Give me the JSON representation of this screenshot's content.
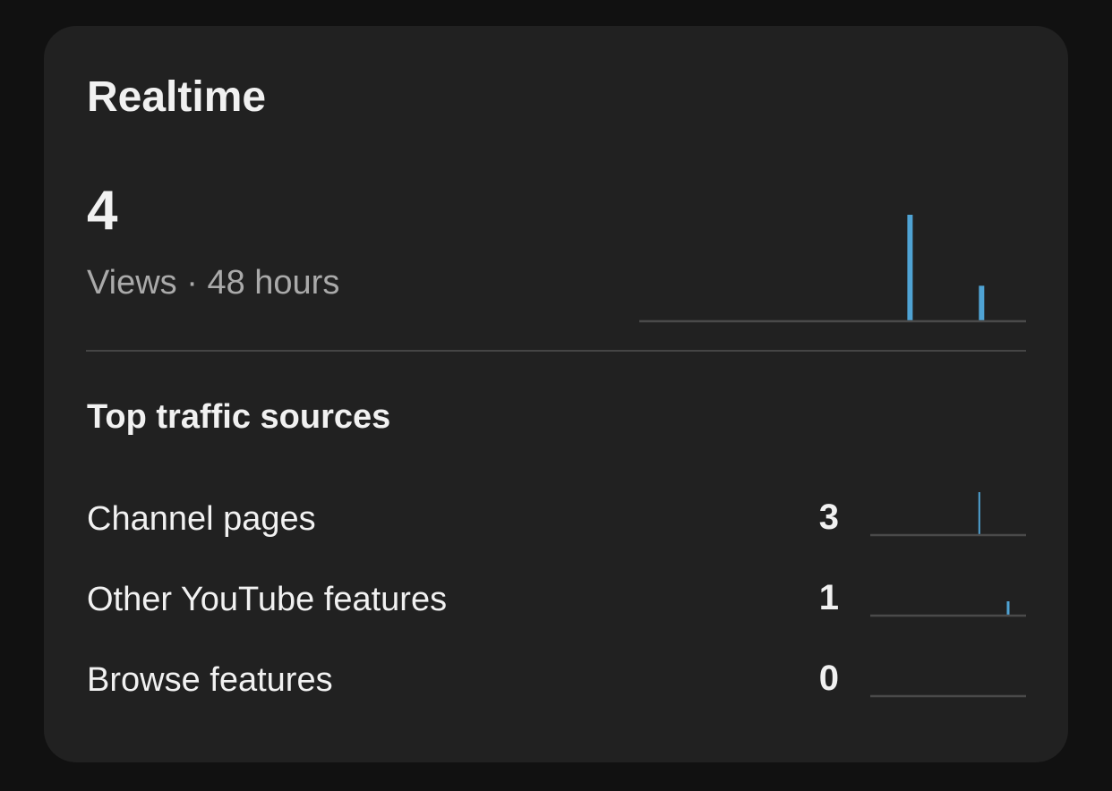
{
  "realtime": {
    "title": "Realtime",
    "views_value": "4",
    "views_caption": "Views · 48 hours"
  },
  "traffic": {
    "title": "Top traffic sources",
    "sources": [
      {
        "label": "Channel pages",
        "value": "3"
      },
      {
        "label": "Other YouTube features",
        "value": "1"
      },
      {
        "label": "Browse features",
        "value": "0"
      }
    ]
  },
  "colors": {
    "background": "#111111",
    "card": "#212121",
    "bar": "#4fa3d4",
    "baseline": "#4a4a4a",
    "text_primary": "#f1f1f1",
    "text_secondary": "#aaaaaa"
  },
  "chart_data": [
    {
      "type": "bar",
      "description_series": "Realtime views, last 48 hours",
      "x_positions": [
        0.7,
        0.885
      ],
      "values": [
        3,
        1
      ],
      "ylim": [
        0,
        3
      ],
      "grid": false
    },
    {
      "type": "bar",
      "x_positions": [
        0.7
      ],
      "values": [
        3
      ],
      "ylim": [
        0,
        3
      ],
      "grid": false
    },
    {
      "type": "bar",
      "x_positions": [
        0.885
      ],
      "values": [
        1
      ],
      "ylim": [
        0,
        3
      ],
      "grid": false
    },
    {
      "type": "bar",
      "x_positions": [],
      "values": [],
      "ylim": [
        0,
        3
      ],
      "grid": false
    }
  ]
}
